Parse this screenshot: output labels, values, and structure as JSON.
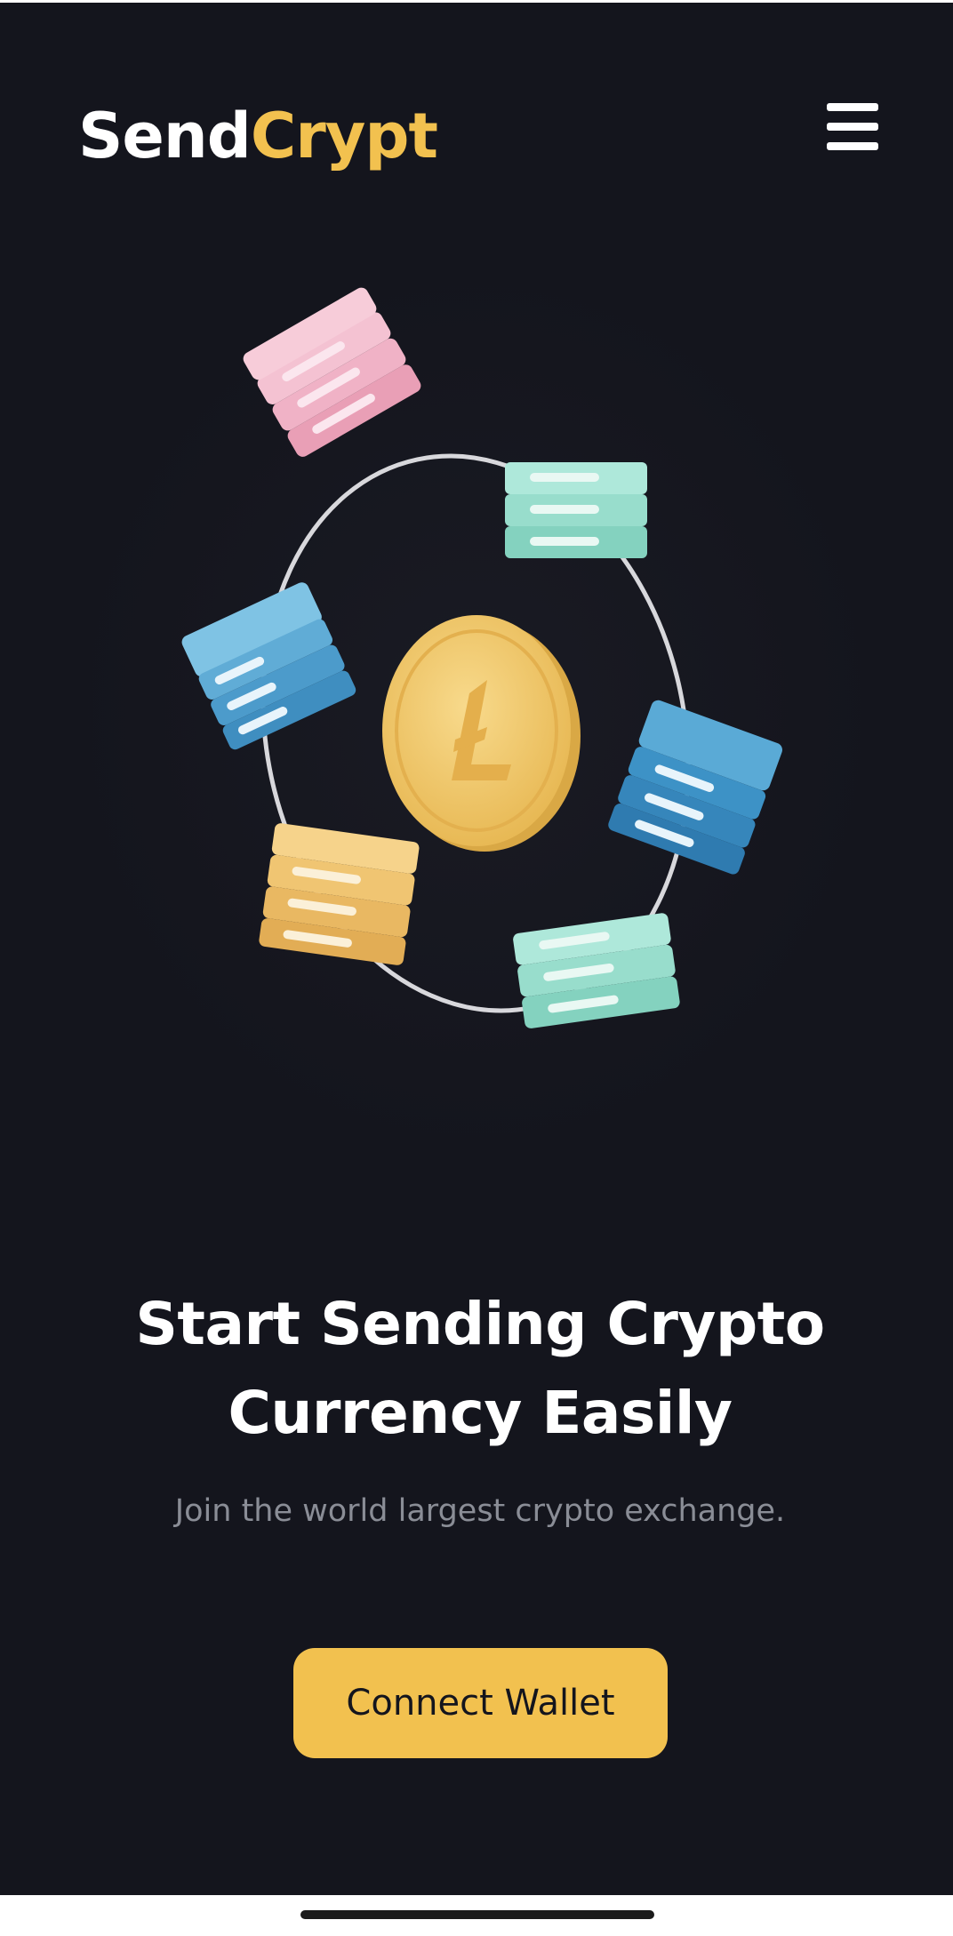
{
  "brand": {
    "name_part_1": "Send",
    "name_part_2": "Crypt",
    "accent_color": "#f2c14f"
  },
  "header": {
    "menu_icon": "hamburger-menu-icon"
  },
  "illustration": {
    "center_icon": "litecoin-coin-icon",
    "node_icon": "server-stack-icon",
    "node_colors": [
      "#f2b6c9",
      "#8fdcc8",
      "#5aaed2",
      "#3d98c8",
      "#f2c877",
      "#8fdcc8"
    ]
  },
  "hero": {
    "title_line_1": "Start Sending Crypto",
    "title_line_2": "Currency Easily",
    "subtitle": "Join the world largest crypto exchange.",
    "cta_label": "Connect Wallet"
  },
  "colors": {
    "background": "#14151d",
    "text_primary": "#ffffff",
    "text_muted": "#8a8d96"
  }
}
